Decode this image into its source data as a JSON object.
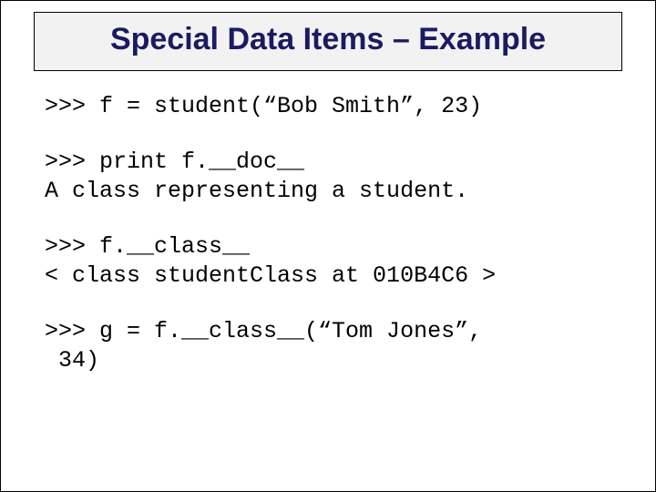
{
  "slide": {
    "title": "Special Data Items – Example"
  },
  "code": {
    "block1": ">>> f = student(“Bob Smith”, 23)",
    "block2": ">>> print f.__doc__\nA class representing a student.",
    "block3": ">>> f.__class__\n< class studentClass at 010B4C6 >",
    "block4": ">>> g = f.__class__(“Tom Jones”,\n 34)"
  }
}
